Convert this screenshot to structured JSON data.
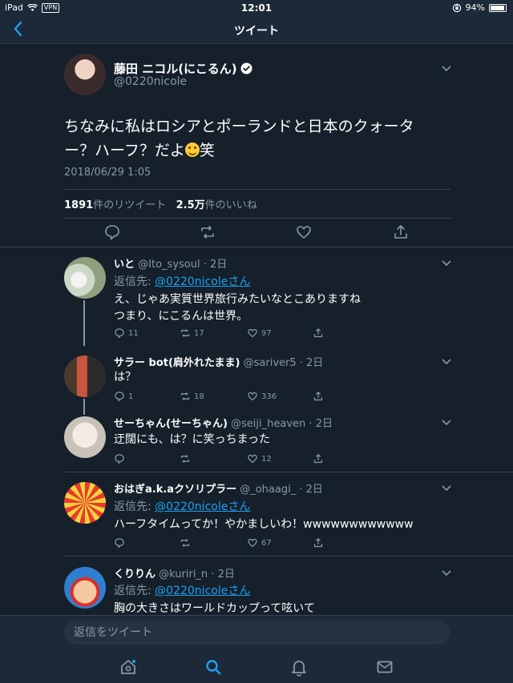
{
  "status": {
    "device": "iPad",
    "vpn": "VPN",
    "time": "12:01",
    "battery": "94%",
    "battery_level": 0.94
  },
  "nav": {
    "title": "ツイート",
    "back_icon": "chevron-left-icon"
  },
  "main_tweet": {
    "name": "藤田 ニコル(にこるん)",
    "handle": "@0220nicole",
    "verified": true,
    "text_line1": "ちなみに私はロシアとポーランドと日本のクォータ",
    "text_line2": "ー？ハーフ？だよ",
    "text_emoji": "smile-emoji",
    "text_after": "笑",
    "date": "2018/06/29 1:05",
    "retweets_count": "1891",
    "retweets_label": "件のリツイート",
    "likes_count": "2.5万",
    "likes_label": "件のいいね",
    "accent": "#1da1f2",
    "bg": "#15202b"
  },
  "replies": [
    {
      "name": "いと",
      "handle": "@Ito_sysoul · 2日",
      "reply_to_label": "返信先: ",
      "reply_to": "@0220nicoleさん",
      "lines": [
        "え、じゃあ実質世界旅行みたいなとこありますね",
        "つまり、にこるんは世界。"
      ],
      "replies": "11",
      "retweets": "17",
      "likes": "97"
    },
    {
      "name": "サラー bot(肩外れたまま)",
      "handle": "@sariver5 · 2日",
      "lines": [
        "は？"
      ],
      "replies": "1",
      "retweets": "18",
      "likes": "336"
    },
    {
      "name": "せーちゃん(せーちゃん)",
      "handle": "@seiji_heaven · 2日",
      "lines": [
        "迂闊にも、は？に笑っちまった"
      ],
      "replies": "",
      "retweets": "",
      "likes": "12"
    },
    {
      "name": "おはぎa.k.aクソリプラー",
      "handle": "@_ohaagi_ · 2日",
      "reply_to_label": "返信先: ",
      "reply_to": "@0220nicoleさん",
      "lines": [
        "ハーフタイムってか！やかましいわ！wwwwwwwwwwww"
      ],
      "replies": "",
      "retweets": "",
      "likes": "67"
    },
    {
      "name": "くりりん",
      "handle": "@kuriri_n · 2日",
      "reply_to_label": "返信先: ",
      "reply_to": "@0220nicoleさん",
      "lines": [
        "胸の大きさはワールドカップって呟いて"
      ]
    }
  ],
  "reply_box": {
    "placeholder": "返信をツイート"
  },
  "tabs": [
    "home-icon",
    "search-icon",
    "notifications-icon",
    "messages-icon"
  ]
}
